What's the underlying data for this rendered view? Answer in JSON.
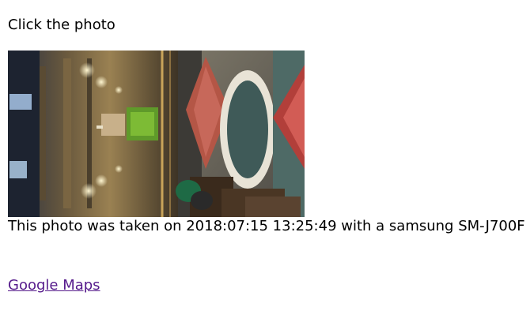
{
  "instruction": "Click the photo",
  "photo": {
    "alt": "Church interior photo",
    "subject": "church-interior"
  },
  "caption": {
    "text": "This photo was taken on 2018:07:15 13:25:49 with a samsung SM-J700F"
  },
  "maps_link": {
    "label": "Google Maps",
    "color": "#551a8b"
  }
}
